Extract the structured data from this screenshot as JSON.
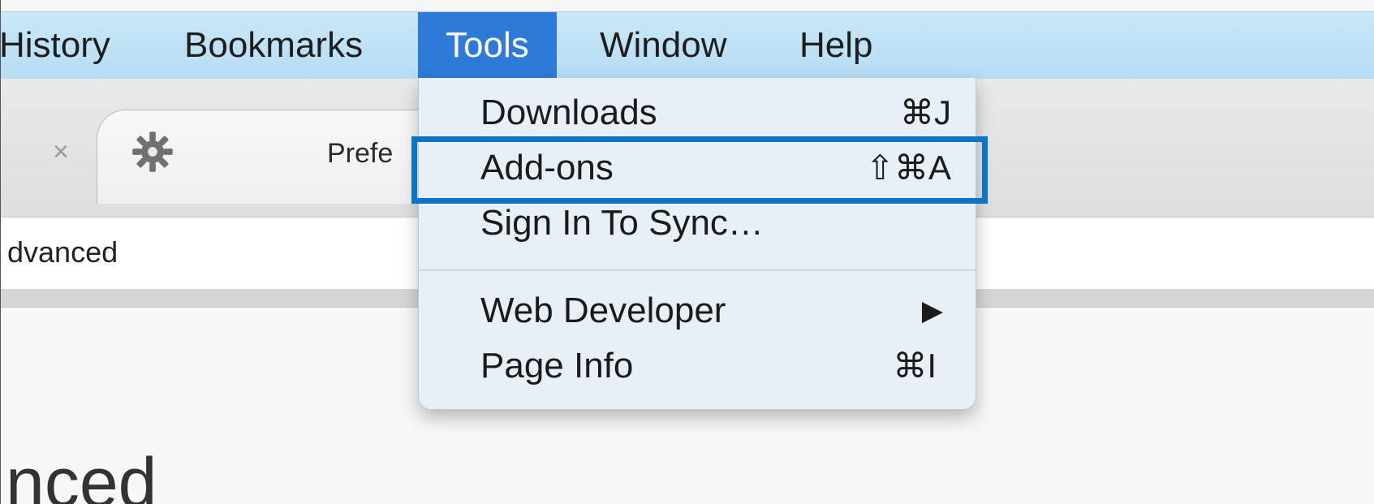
{
  "menubar": {
    "items": [
      {
        "label": "History"
      },
      {
        "label": "Bookmarks"
      },
      {
        "label": "Tools"
      },
      {
        "label": "Window"
      },
      {
        "label": "Help"
      }
    ],
    "active": "Tools"
  },
  "tab": {
    "close": "×",
    "title": "Prefe"
  },
  "url": {
    "text": "dvanced"
  },
  "page": {
    "heading": "nced"
  },
  "tools_menu": {
    "items": [
      {
        "label": "Downloads",
        "shortcut": "⌘J"
      },
      {
        "label": "Add-ons",
        "shortcut": "⇧⌘A"
      },
      {
        "label": "Sign In To Sync…",
        "shortcut": ""
      },
      {
        "label": "Web Developer",
        "shortcut": "▶"
      },
      {
        "label": "Page Info",
        "shortcut": "⌘I"
      }
    ],
    "highlighted": "Add-ons"
  },
  "colors": {
    "highlight_border": "#0a74c6",
    "active_menu_bg": "#2d7ad9",
    "menubar_bg": "#c1e2f6"
  },
  "icons": {
    "tab_icon": "gear-icon",
    "submenu_arrow": "triangle-right-icon"
  }
}
